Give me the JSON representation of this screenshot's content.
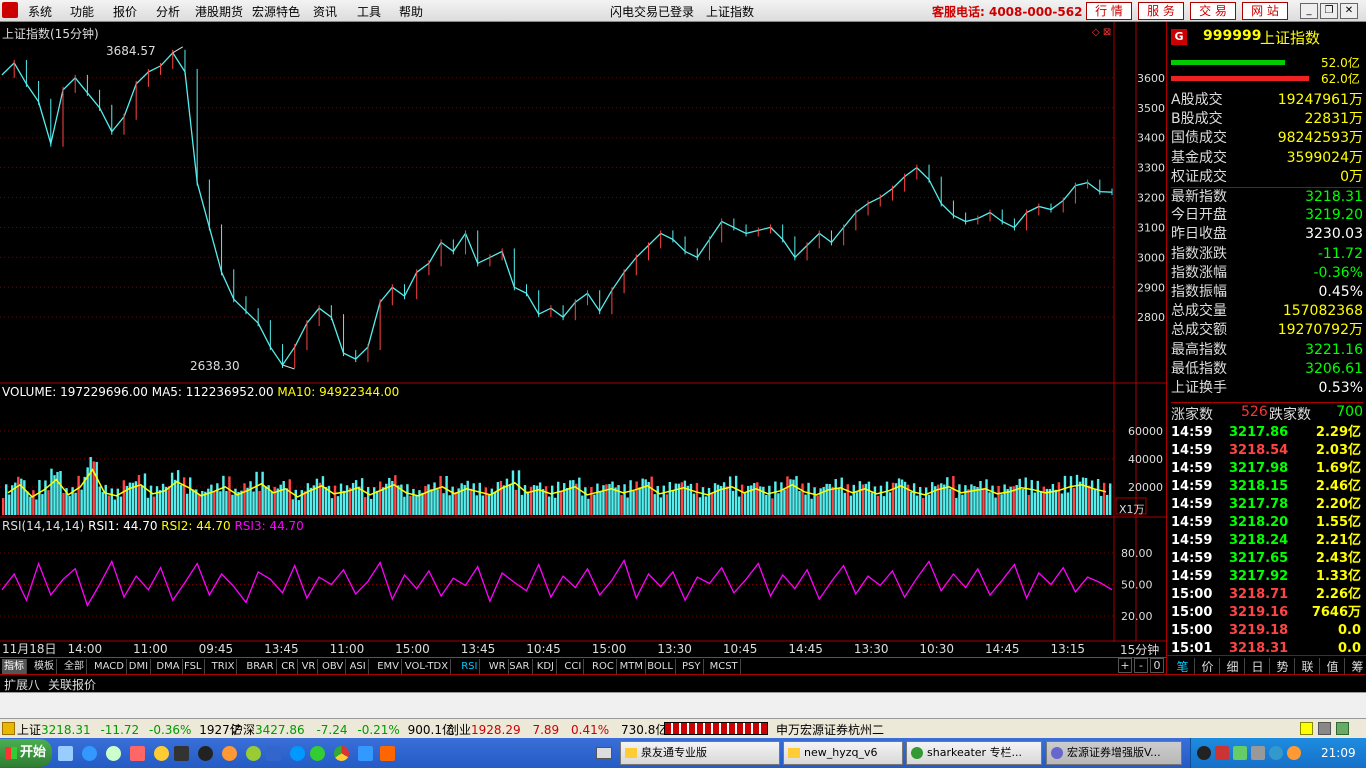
{
  "menu": [
    "系统",
    "功能",
    "报价",
    "分析",
    "港股期货",
    "宏源特色",
    "资讯",
    "工具",
    "帮助"
  ],
  "menu_status": "闪电交易已登录",
  "menu_index": "上证指数",
  "service": "客服电话: 4008-000-562",
  "menu_buttons": [
    "行 情",
    "服 务",
    "交 易",
    "网 站"
  ],
  "chart_title": "上证指数(15分钟)",
  "price": {
    "high_label": "3684.57",
    "low_label": "2638.30",
    "ylim": [
      2600,
      3720
    ],
    "ticks": [
      3600,
      3500,
      3400,
      3300,
      3200,
      3100,
      3000,
      2900,
      2800
    ],
    "close": [
      3610,
      3650,
      3580,
      3520,
      3380,
      3560,
      3600,
      3550,
      3500,
      3420,
      3470,
      3580,
      3620,
      3640,
      3684,
      3620,
      3250,
      3100,
      2950,
      2860,
      2820,
      2780,
      2700,
      2640,
      2700,
      2780,
      2830,
      2800,
      2680,
      2660,
      2700,
      2850,
      2900,
      2870,
      2950,
      2980,
      3050,
      3020,
      3080,
      2980,
      3000,
      3020,
      2900,
      2880,
      2810,
      2830,
      2800,
      2850,
      2880,
      2820,
      2890,
      2950,
      3000,
      3040,
      3080,
      3060,
      3020,
      3000,
      3060,
      3120,
      3100,
      3080,
      3090,
      3100,
      3060,
      3000,
      3040,
      3080,
      3050,
      3100,
      3150,
      3180,
      3200,
      3230,
      3270,
      3300,
      3260,
      3180,
      3140,
      3120,
      3130,
      3150,
      3120,
      3100,
      3150,
      3170,
      3160,
      3190,
      3240,
      3250,
      3220,
      3218
    ]
  },
  "volume": {
    "label": "VOLUME: 197229696.00",
    "ma5": "MA5: 112236952.00",
    "ma10": "MA10: 94922344.00",
    "ticks": [
      "60000",
      "40000",
      "20000"
    ],
    "unit": "X1万",
    "ylim": [
      0,
      70000
    ],
    "values": [
      22000,
      30000,
      18000,
      25000,
      35000,
      20000,
      28000,
      45000,
      22000,
      19000,
      26000,
      30000,
      21000,
      24000,
      33000,
      27000,
      19000,
      23000,
      28000,
      20000,
      25000,
      31000,
      22000,
      26000,
      18000,
      24000,
      29000,
      21000,
      23000,
      27000,
      20000,
      25000,
      30000,
      22000,
      19000,
      24000,
      28000,
      21000,
      26000,
      23000,
      20000,
      27000,
      32000,
      22000,
      25000,
      21000,
      24000,
      28000,
      20000,
      23000,
      26000,
      22000,
      25000,
      29000,
      21000,
      24000,
      27000,
      23000,
      20000,
      25000,
      28000,
      22000,
      26000,
      21000,
      24000,
      30000,
      23000,
      20000,
      25000,
      27000,
      22000,
      26000,
      21000,
      24000,
      29000,
      23000,
      20000,
      25000,
      28000,
      22000,
      24000,
      26000,
      21000,
      23000,
      27000,
      25000,
      22000,
      24000,
      28000,
      30000,
      26000,
      23000
    ]
  },
  "rsi": {
    "label": "RSI(14,14,14)",
    "rsi1": "RSI1: 44.70",
    "rsi2": "RSI2: 44.70",
    "rsi3": "RSI3: 44.70",
    "ticks": [
      "80.00",
      "50.00",
      "20.00"
    ],
    "ylim": [
      0,
      100
    ],
    "values": [
      45,
      60,
      35,
      70,
      40,
      55,
      65,
      30,
      50,
      72,
      38,
      58,
      45,
      66,
      35,
      52,
      70,
      40,
      60,
      48,
      33,
      62,
      55,
      42,
      68,
      37,
      57,
      50,
      64,
      41,
      53,
      71,
      36,
      59,
      46,
      63,
      39,
      56,
      49,
      67,
      34,
      61,
      52,
      44,
      69,
      38,
      58,
      47,
      65,
      40,
      54,
      73,
      37,
      60,
      48,
      62,
      35,
      57,
      51,
      66,
      42,
      55,
      70,
      39,
      59,
      46,
      64,
      36,
      53,
      68,
      41,
      58,
      49,
      63,
      38,
      56,
      72,
      44,
      60,
      47,
      65,
      40,
      54,
      69,
      37,
      61,
      50,
      66,
      43,
      57,
      52,
      45
    ]
  },
  "time_axis": [
    "11月18日",
    "14:00",
    "11:00",
    "09:45",
    "13:45",
    "11:00",
    "15:00",
    "13:45",
    "10:45",
    "15:00",
    "13:30",
    "10:45",
    "14:45",
    "13:30",
    "10:30",
    "14:45",
    "13:15"
  ],
  "period_label": "15分钟",
  "right": {
    "code": "999999",
    "name": "上证指数",
    "bar1": "52.0亿",
    "bar2": "62.0亿",
    "stats": [
      [
        "A股成交",
        "19247961万",
        "#ff0"
      ],
      [
        "B股成交",
        "22831万",
        "#ff0"
      ],
      [
        "国债成交",
        "98242593万",
        "#ff0"
      ],
      [
        "基金成交",
        "3599024万",
        "#ff0"
      ],
      [
        "权证成交",
        "0万",
        "#ff0"
      ],
      [
        "最新指数",
        "3218.31",
        "#0f0"
      ],
      [
        "今日开盘",
        "3219.20",
        "#0f0"
      ],
      [
        "昨日收盘",
        "3230.03",
        "#fff"
      ],
      [
        "指数涨跌",
        "-11.72",
        "#0f0"
      ],
      [
        "指数涨幅",
        "-0.36%",
        "#0f0"
      ],
      [
        "指数振幅",
        "0.45%",
        "#fff"
      ],
      [
        "总成交量",
        "157082368",
        "#ff0"
      ],
      [
        "总成交额",
        "19270792万",
        "#ff0"
      ],
      [
        "最高指数",
        "3221.16",
        "#0f0"
      ],
      [
        "最低指数",
        "3206.61",
        "#0f0"
      ],
      [
        "上证换手",
        "0.53%",
        "#fff"
      ]
    ],
    "up_label": "涨家数",
    "up": "526",
    "down_label": "跌家数",
    "down": "700",
    "ticks": [
      [
        "14:59",
        "3217.86",
        "2.29亿"
      ],
      [
        "14:59",
        "3218.54",
        "2.03亿"
      ],
      [
        "14:59",
        "3217.98",
        "1.69亿"
      ],
      [
        "14:59",
        "3218.15",
        "2.46亿"
      ],
      [
        "14:59",
        "3217.78",
        "2.20亿"
      ],
      [
        "14:59",
        "3218.20",
        "1.55亿"
      ],
      [
        "14:59",
        "3218.24",
        "2.21亿"
      ],
      [
        "14:59",
        "3217.65",
        "2.43亿"
      ],
      [
        "14:59",
        "3217.92",
        "1.33亿"
      ],
      [
        "15:00",
        "3218.71",
        "2.26亿"
      ],
      [
        "15:00",
        "3219.16",
        "7646万"
      ],
      [
        "15:00",
        "3219.18",
        "0.0"
      ],
      [
        "15:01",
        "3218.31",
        "0.0"
      ]
    ],
    "bottom_tabs": [
      "笔",
      "价",
      "细",
      "日",
      "势",
      "联",
      "值",
      "筹"
    ]
  },
  "ind_tabs": [
    "指标",
    "模板",
    "全部",
    "MACD",
    "DMI",
    "DMA",
    "FSL",
    "TRIX",
    "BRAR",
    "CR",
    "VR",
    "OBV",
    "ASI",
    "EMV",
    "VOL-TDX",
    "RSI",
    "WR",
    "SAR",
    "KDJ",
    "CCI",
    "ROC",
    "MTM",
    "BOLL",
    "PSY",
    "MCST"
  ],
  "ext_tabs": [
    "扩展八",
    "关联报价"
  ],
  "status": {
    "sh_name": "上证",
    "sh_val": "3218.31",
    "sh_chg": "-11.72",
    "sh_pct": "-0.36%",
    "sh_amt": "1927亿",
    "sz_name": "沪深",
    "sz_val": "3427.86",
    "sz_chg": "-7.24",
    "sz_pct": "-0.21%",
    "sz_amt": "900.1亿",
    "cy_name": "创业",
    "cy_val": "1928.29",
    "cy_chg": "7.89",
    "cy_pct": "0.41%",
    "cy_amt": "730.8亿",
    "broker": "申万宏源证券杭州二"
  },
  "taskbar": {
    "start": "开始",
    "tasks": [
      "泉友通专业版",
      "new_hyzq_v6",
      "sharkeater 专栏...",
      "宏源证券增强版V..."
    ],
    "clock": "21:09"
  }
}
